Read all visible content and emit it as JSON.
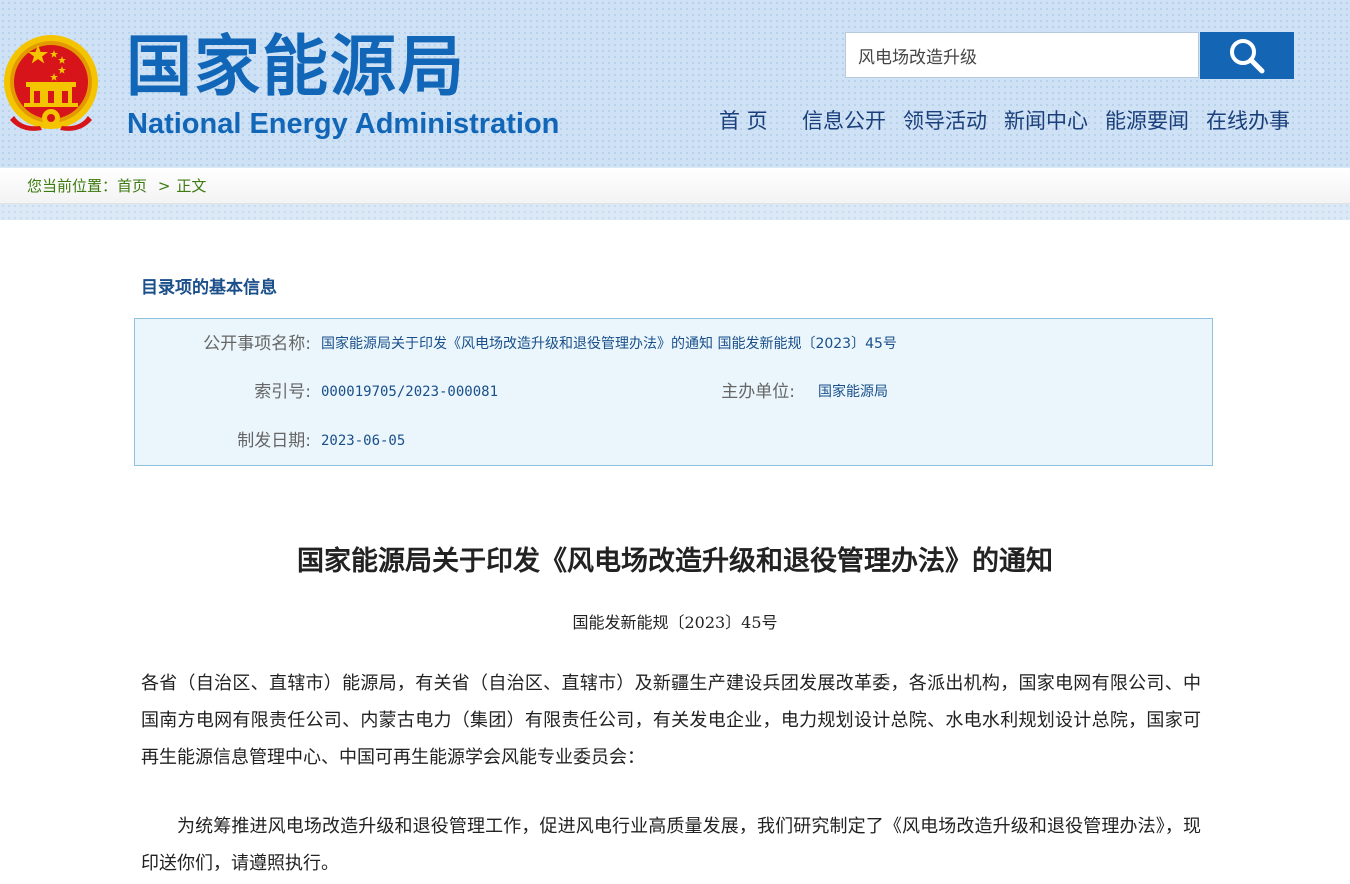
{
  "header": {
    "logo_cn": "国家能源局",
    "logo_en": "National Energy Administration",
    "search": {
      "value": "风电场改造升级"
    },
    "nav": [
      "首 页",
      "信息公开",
      "领导活动",
      "新闻中心",
      "能源要闻",
      "在线办事"
    ]
  },
  "breadcrumb": {
    "prefix": "您当前位置：",
    "home": "首页",
    "separator": ">",
    "current": "正文"
  },
  "info": {
    "section_title": "目录项的基本信息",
    "name_label": "公开事项名称:",
    "name_value": "国家能源局关于印发《风电场改造升级和退役管理办法》的通知 国能发新能规〔2023〕45号",
    "index_label": "索引号:",
    "index_value": "000019705/2023-000081",
    "org_label": "主办单位:",
    "org_value": "国家能源局",
    "date_label": "制发日期:",
    "date_value": "2023-06-05"
  },
  "article": {
    "title": "国家能源局关于印发《风电场改造升级和退役管理办法》的通知",
    "doc_number": "国能发新能规〔2023〕45号",
    "paragraphs": [
      "各省（自治区、直辖市）能源局，有关省（自治区、直辖市）及新疆生产建设兵团发展改革委，各派出机构，国家电网有限公司、中国南方电网有限责任公司、内蒙古电力（集团）有限责任公司，有关发电企业，电力规划设计总院、水电水利规划设计总院，国家可再生能源信息管理中心、中国可再生能源学会风能专业委员会：",
      "为统筹推进风电场改造升级和退役管理工作，促进风电行业高质量发展，我们研究制定了《风电场改造升级和退役管理办法》，现印送你们，请遵照执行。"
    ]
  },
  "colors": {
    "brand_blue": "#1266b8",
    "search_button": "#1565b5",
    "breadcrumb_green": "#3d7a0f",
    "info_bg": "#eaf6fc",
    "emblem_red": "#d7141a",
    "emblem_gold": "#f5c400"
  },
  "icons": {
    "emblem": "national-emblem-icon",
    "search": "search-icon"
  }
}
